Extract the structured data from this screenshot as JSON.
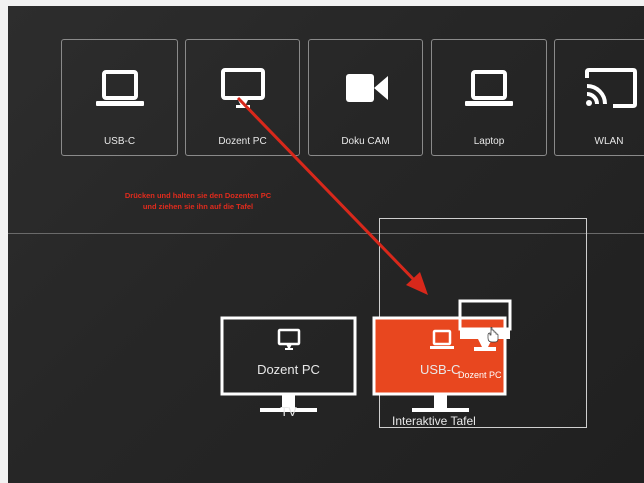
{
  "sources": [
    {
      "label": "USB-C",
      "icon": "laptop-icon"
    },
    {
      "label": "Dozent PC",
      "icon": "monitor-icon"
    },
    {
      "label": "Doku CAM",
      "icon": "camera-icon"
    },
    {
      "label": "Laptop",
      "icon": "laptop-icon"
    },
    {
      "label": "WLAN",
      "icon": "cast-icon"
    }
  ],
  "hint": {
    "line1": "Drücken und halten sie den Dozenten PC",
    "line2": "und ziehen sie ihn auf die Tafel"
  },
  "displays": {
    "tv": {
      "source_label": "Dozent PC",
      "name": "TV"
    },
    "tafel": {
      "source_label": "USB-C",
      "name": "Interaktive Tafel"
    }
  },
  "dragging": {
    "label": "Dozent PC",
    "icon": "monitor-icon"
  },
  "colors": {
    "accent": "#e8471f",
    "hint": "#e02b1d",
    "annotation_arrow": "#d8281b"
  }
}
